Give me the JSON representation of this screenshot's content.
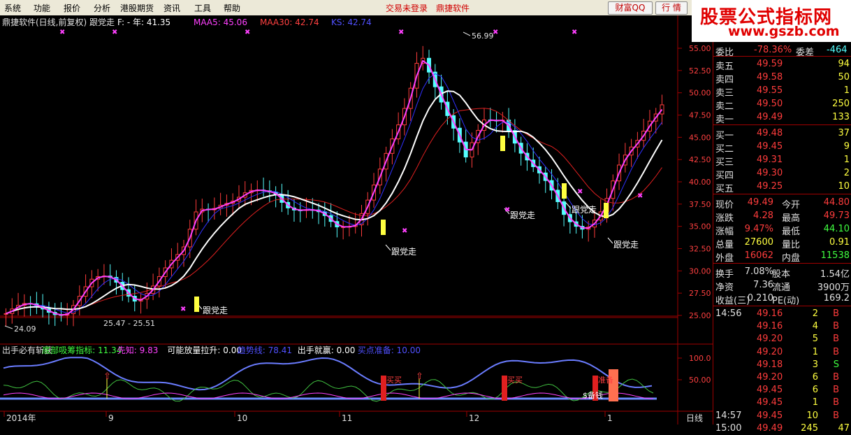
{
  "menu": [
    "系统",
    "功能",
    "报价",
    "分析",
    "港股期货",
    "资讯",
    "工具",
    "帮助"
  ],
  "center_status": [
    "交易未登录",
    "鼎捷软件"
  ],
  "buttons": {
    "caifu": "财富QQ",
    "hangqing": "行 情"
  },
  "logo": {
    "line1": "股票公式指标网",
    "line2": "www.gszb.com"
  },
  "main": {
    "title": "鼎捷软件(日线,前复权) 跟党走",
    "indicators": [
      {
        "text": "F: - 年: 41.35",
        "color": "#ffffff"
      },
      {
        "text": "MAA5: 45.06",
        "color": "#ff40ff"
      },
      {
        "text": "MAA30: 42.74",
        "color": "#ff4040"
      },
      {
        "text": "KS: 42.74",
        "color": "#5050ff"
      }
    ],
    "y_ticks": [
      "55.00",
      "52.50",
      "50.00",
      "47.50",
      "45.00",
      "42.50",
      "40.00",
      "37.50",
      "35.00",
      "32.50",
      "30.00",
      "27.50",
      "25.00"
    ],
    "high_label": "56.99",
    "low_label": "24.09",
    "range_label": "25.47 - 25.51",
    "signal_label": "跟党走"
  },
  "sub": {
    "indicators": [
      {
        "text": "出手必有斩获",
        "color": "#e0e0e0"
      },
      {
        "text": "底部吸筹指标: 11.34",
        "color": "#40ff40"
      },
      {
        "text": "先知: 9.83",
        "color": "#ff40ff"
      },
      {
        "text": "可能放量拉升: 0.00",
        "color": "#ffffff"
      },
      {
        "text": "趋势线: 78.41",
        "color": "#5050ff"
      },
      {
        "text": "出手就赢: 0.00",
        "color": "#ffffff"
      },
      {
        "text": "买点准备: 10.00",
        "color": "#5050ff"
      }
    ],
    "y_ticks": [
      "100.0",
      "50.00"
    ],
    "label_buy": "买买",
    "label_ready": "准备",
    "label_money": "$备钱"
  },
  "x_axis": {
    "labels": [
      "2014年",
      "9",
      "10",
      "11",
      "12",
      "1"
    ],
    "period": "日线"
  },
  "orderbook": {
    "header": [
      {
        "label": "委比",
        "value": "-78.36%"
      },
      {
        "label": "委差",
        "value": "-464"
      }
    ],
    "asks": [
      {
        "label": "卖五",
        "price": "49.59",
        "vol": "94"
      },
      {
        "label": "卖四",
        "price": "49.58",
        "vol": "50"
      },
      {
        "label": "卖三",
        "price": "49.55",
        "vol": "1"
      },
      {
        "label": "卖二",
        "price": "49.50",
        "vol": "250"
      },
      {
        "label": "卖一",
        "price": "49.49",
        "vol": "133"
      }
    ],
    "bids": [
      {
        "label": "买一",
        "price": "49.48",
        "vol": "37"
      },
      {
        "label": "买二",
        "price": "49.45",
        "vol": "9"
      },
      {
        "label": "买三",
        "price": "49.31",
        "vol": "1"
      },
      {
        "label": "买四",
        "price": "49.30",
        "vol": "2"
      },
      {
        "label": "买五",
        "price": "49.25",
        "vol": "10"
      }
    ]
  },
  "stats": [
    [
      {
        "label": "现价",
        "value": "49.49"
      },
      {
        "label": "今开",
        "value": "44.80"
      }
    ],
    [
      {
        "label": "涨跌",
        "value": "4.28"
      },
      {
        "label": "最高",
        "value": "49.73"
      }
    ],
    [
      {
        "label": "涨幅",
        "value": "9.47%"
      },
      {
        "label": "最低",
        "value": "44.10"
      }
    ],
    [
      {
        "label": "总量",
        "value": "27600"
      },
      {
        "label": "量比",
        "value": "0.91"
      }
    ],
    [
      {
        "label": "外盘",
        "value": "16062"
      },
      {
        "label": "内盘",
        "value": "11538"
      }
    ]
  ],
  "info": [
    [
      {
        "label": "换手",
        "value": "7.08%"
      },
      {
        "label": "股本",
        "value": "1.54亿"
      }
    ],
    [
      {
        "label": "净资",
        "value": "7.36"
      },
      {
        "label": "流通",
        "value": "3900万"
      }
    ],
    [
      {
        "label": "收益(三)",
        "value": "0.210"
      },
      {
        "label": "PE(动)",
        "value": "169.2"
      }
    ]
  ],
  "ticks": [
    {
      "time": "14:56",
      "price": "49.16",
      "vol": "2",
      "side": "B"
    },
    {
      "time": "",
      "price": "49.16",
      "vol": "4",
      "side": "B"
    },
    {
      "time": "",
      "price": "49.20",
      "vol": "5",
      "side": "B"
    },
    {
      "time": "",
      "price": "49.20",
      "vol": "1",
      "side": "B"
    },
    {
      "time": "",
      "price": "49.18",
      "vol": "3",
      "side": "S"
    },
    {
      "time": "",
      "price": "49.20",
      "vol": "6",
      "side": "B"
    },
    {
      "time": "",
      "price": "49.45",
      "vol": "6",
      "side": "B"
    },
    {
      "time": "",
      "price": "49.45",
      "vol": "1",
      "side": "B"
    },
    {
      "time": "14:57",
      "price": "49.45",
      "vol": "10",
      "side": "B"
    },
    {
      "time": "15:00",
      "price": "49.49",
      "vol": "245",
      "side": "47"
    }
  ],
  "colors": {
    "up": "#ff3c3c",
    "down": "#54ffff",
    "ma5": "#ff40ff",
    "ma30": "#e02020",
    "ks": "#3030ff",
    "white": "#ffffff"
  }
}
